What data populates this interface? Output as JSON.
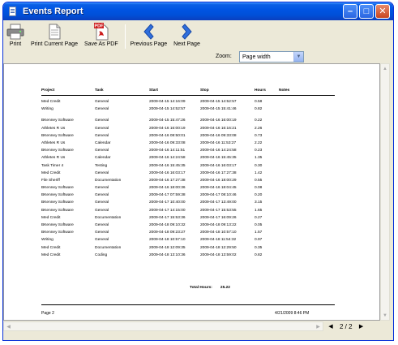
{
  "window": {
    "title": "Events Report"
  },
  "toolbar": {
    "print": "Print",
    "print_current": "Print Current Page",
    "save_pdf": "Save As PDF",
    "prev_page": "Previous Page",
    "next_page": "Next Page",
    "pdf_badge": "PDF"
  },
  "zoom": {
    "label": "Zoom:",
    "value": "Page width"
  },
  "report": {
    "columns": [
      "Project",
      "Task",
      "Start",
      "Stop",
      "Hours",
      "Notes"
    ],
    "rows": [
      [
        "Med Credit",
        "General",
        "2009-04-15 14:16:09",
        "2009-04-15 14:52:57",
        "0.58",
        ""
      ],
      [
        "Writing",
        "General",
        "2009-04-15 14:52:57",
        "2009-04-15 15:41:46",
        "0.82",
        ""
      ],
      [
        "BKenney Software",
        "General",
        "2009-04-15 15:47:26",
        "2009-04-16 16:00:19",
        "0.22",
        ""
      ],
      [
        "Athletes R Us",
        "General",
        "2009-04-16 16:00:19",
        "2009-04-16 16:16:21",
        "2.26",
        ""
      ],
      [
        "BKenney Software",
        "General",
        "2009-04-16 08:50:01",
        "2009-04-16 09:33:08",
        "0.73",
        ""
      ],
      [
        "Athletes R Us",
        "Calendar",
        "2009-04-16 09:33:08",
        "2009-04-16 11:53:27",
        "2.22",
        ""
      ],
      [
        "BKenney Software",
        "General",
        "2009-04-16 14:11:51",
        "2009-04-16 14:24:58",
        "0.23",
        ""
      ],
      [
        "Athletes R Us",
        "Calendar",
        "2009-04-16 14:24:58",
        "2009-04-16 15:45:35",
        "1.35",
        ""
      ],
      [
        "Task Timer 4",
        "Testing",
        "2009-04-16 15:45:35",
        "2009-04-16 16:03:17",
        "0.30",
        ""
      ],
      [
        "Med Credit",
        "General",
        "2009-04-16 16:03:17",
        "2009-04-16 17:27:38",
        "1.42",
        ""
      ],
      [
        "File Sheriff",
        "Documentation",
        "2009-04-16 17:27:38",
        "2009-04-16 18:00:29",
        "0.55",
        ""
      ],
      [
        "BKenney Software",
        "General",
        "2009-04-16 18:00:36",
        "2009-04-16 18:04:45",
        "0.08",
        ""
      ],
      [
        "BKenney Software",
        "General",
        "2009-04-17 07:59:38",
        "2009-04-17 08:10:46",
        "0.20",
        ""
      ],
      [
        "BKenney Software",
        "General",
        "2009-04-17 10:40:00",
        "2009-04-17 13:49:00",
        "3.15",
        ""
      ],
      [
        "BKenney Software",
        "General",
        "2009-04-17 14:15:00",
        "2009-04-17 15:53:55",
        "1.65",
        ""
      ],
      [
        "Med Credit",
        "Documentation",
        "2009-04-17 15:53:36",
        "2009-04-17 16:09:26",
        "0.27",
        ""
      ],
      [
        "BKenney Software",
        "General",
        "2009-04-18 09:10:32",
        "2009-04-18 09:13:22",
        "0.05",
        ""
      ],
      [
        "BKenney Software",
        "General",
        "2009-04-18 09:23:27",
        "2009-04-18 10:57:10",
        "1.57",
        ""
      ],
      [
        "Writing",
        "General",
        "2009-04-18 10:57:10",
        "2009-04-18 11:54:32",
        "0.97",
        ""
      ],
      [
        "Med Credit",
        "Documentation",
        "2009-04-18 12:09:35",
        "2009-04-18 12:29:50",
        "0.35",
        ""
      ],
      [
        "Med Credit",
        "Coding",
        "2009-04-18 13:10:36",
        "2009-04-18 13:59:02",
        "0.82",
        ""
      ]
    ],
    "total_label": "Total Hours:",
    "total_value": "25.22",
    "footer_left": "Page 2",
    "footer_right": "4/21/2009 8:46 PM"
  },
  "pager": {
    "text": "2 / 2"
  },
  "icons": {
    "print": "printer-icon",
    "print_current": "page-icon",
    "save_pdf": "pdf-icon",
    "prev": "chevron-left-icon",
    "next": "chevron-right-icon"
  },
  "colors": {
    "titlebar": "#0054e3",
    "chevron": "#2f6fdd",
    "pdf_red": "#cc1b1b"
  }
}
